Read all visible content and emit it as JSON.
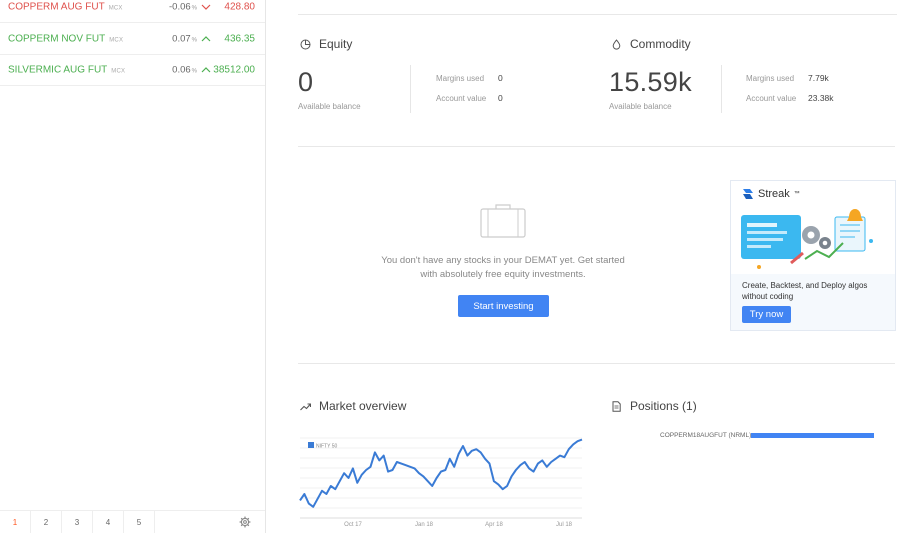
{
  "watchlist": [
    {
      "name": "COPPERM AUG FUT",
      "exchange": "MCX",
      "change": "-0.06",
      "pct": "%",
      "direction": "down",
      "price": "428.80",
      "color": "#df514c"
    },
    {
      "name": "COPPERM NOV FUT",
      "exchange": "MCX",
      "change": "0.07",
      "pct": "%",
      "direction": "up",
      "price": "436.35",
      "color": "#4caf50"
    },
    {
      "name": "SILVERMIC AUG FUT",
      "exchange": "MCX",
      "change": "0.06",
      "pct": "%",
      "direction": "up",
      "price": "38512.00",
      "color": "#4caf50"
    }
  ],
  "pager": {
    "pages": [
      "1",
      "2",
      "3",
      "4",
      "5"
    ],
    "active": "1",
    "settings_icon": "gear-icon"
  },
  "equity": {
    "title": "Equity",
    "icon": "pie-chart-icon",
    "balance": "0",
    "balance_label": "Available balance",
    "margins_used_label": "Margins used",
    "margins_used": "0",
    "account_value_label": "Account value",
    "account_value": "0"
  },
  "commodity": {
    "title": "Commodity",
    "icon": "drop-icon",
    "balance": "15.59k",
    "balance_label": "Available balance",
    "margins_used_label": "Margins used",
    "margins_used": "7.79k",
    "account_value_label": "Account value",
    "account_value": "23.38k"
  },
  "holdings_empty": {
    "icon": "briefcase-icon",
    "message_line1": "You don't have any stocks in your DEMAT yet. Get started",
    "message_line2": "with absolutely free equity investments.",
    "button_label": "Start investing"
  },
  "streak": {
    "logo_text": "Streak",
    "trademark": "™",
    "description": "Create, Backtest, and Deploy algos without coding",
    "button_label": "Try now"
  },
  "market_overview": {
    "title": "Market overview",
    "icon": "trending-up-icon"
  },
  "positions": {
    "title": "Positions (1)",
    "icon": "document-icon",
    "items": [
      {
        "label": "COPPERM18AUGFUT (NRML)",
        "fraction": 1.0
      }
    ]
  },
  "colors": {
    "accent": "#4184f3",
    "loss": "#df514c",
    "gain": "#4caf50",
    "active_page": "#ff5722"
  },
  "chart_data": {
    "type": "line",
    "series": [
      {
        "name": "NIFTY 50",
        "values": [
          0.22,
          0.3,
          0.18,
          0.14,
          0.24,
          0.34,
          0.3,
          0.4,
          0.36,
          0.46,
          0.56,
          0.5,
          0.62,
          0.44,
          0.54,
          0.6,
          0.64,
          0.82,
          0.72,
          0.78,
          0.58,
          0.6,
          0.7,
          0.68,
          0.66,
          0.64,
          0.62,
          0.56,
          0.52,
          0.46,
          0.4,
          0.5,
          0.58,
          0.6,
          0.74,
          0.64,
          0.8,
          0.9,
          0.78,
          0.84,
          0.86,
          0.82,
          0.74,
          0.68,
          0.46,
          0.42,
          0.36,
          0.4,
          0.52,
          0.6,
          0.66,
          0.7,
          0.62,
          0.58,
          0.68,
          0.72,
          0.64,
          0.7,
          0.74,
          0.78,
          0.76,
          0.86,
          0.92,
          0.96,
          0.98
        ]
      }
    ],
    "x_ticks": [
      "Oct 17",
      "Jan 18",
      "Apr 18",
      "Jul 18"
    ],
    "ylim": [
      0,
      1
    ],
    "grid": true,
    "legend": "top-left"
  }
}
